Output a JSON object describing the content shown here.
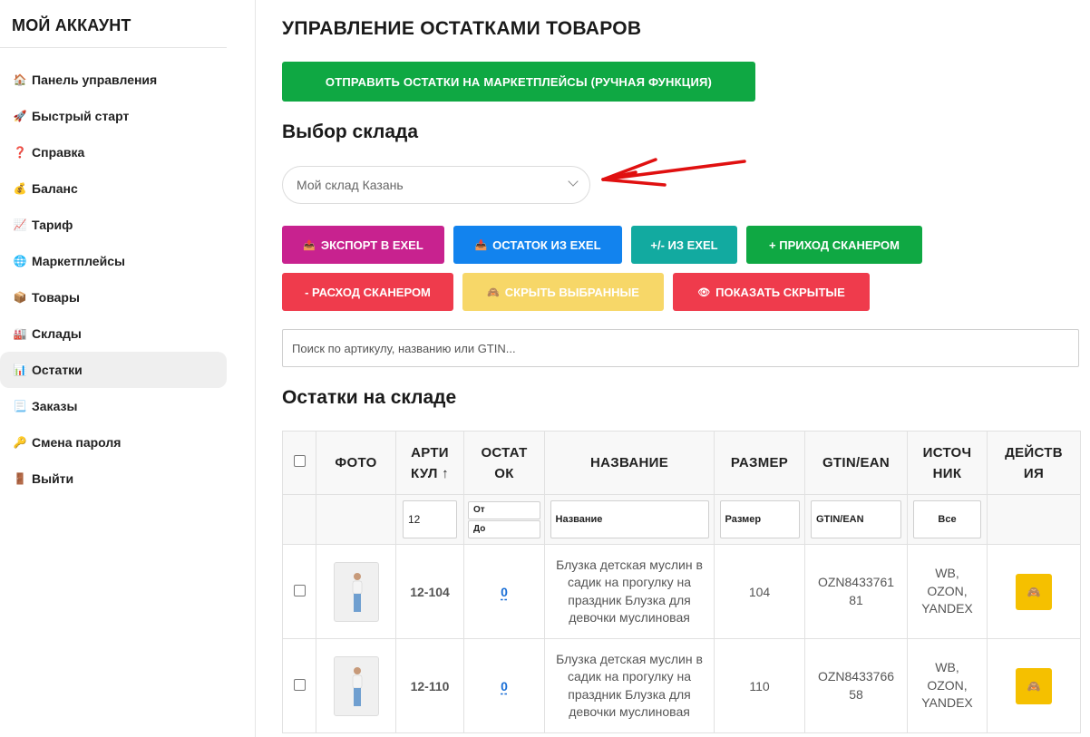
{
  "sidebar": {
    "title": "МОЙ АККАУНТ",
    "items": [
      {
        "icon": "🏠",
        "label": "Панель управления"
      },
      {
        "icon": "🚀",
        "label": "Быстрый старт"
      },
      {
        "icon": "❓",
        "label": "Справка"
      },
      {
        "icon": "💰",
        "label": "Баланс"
      },
      {
        "icon": "📈",
        "label": "Тариф"
      },
      {
        "icon": "🌐",
        "label": "Маркетплейсы"
      },
      {
        "icon": "📦",
        "label": "Товары"
      },
      {
        "icon": "🏭",
        "label": "Склады"
      },
      {
        "icon": "📊",
        "label": "Остатки"
      },
      {
        "icon": "📃",
        "label": "Заказы"
      },
      {
        "icon": "🔑",
        "label": "Смена пароля"
      },
      {
        "icon": "🚪",
        "label": "Выйти"
      }
    ]
  },
  "main": {
    "title": "УПРАВЛЕНИЕ ОСТАТКАМИ ТОВАРОВ",
    "send_button": "ОТПРАВИТЬ ОСТАТКИ НА МАРКЕТПЛЕЙСЫ (РУЧНАЯ ФУНКЦИЯ)",
    "warehouse_heading": "Выбор склада",
    "warehouse_selected": "Мой склад Казань",
    "buttons": {
      "export_icon": "📤",
      "export": "ЭКСПОРТ В EXEL",
      "import_icon": "📥",
      "import": "ОСТАТОК ИЗ EXEL",
      "plusminus": "+/- ИЗ EXEL",
      "income": "+ ПРИХОД СКАНЕРОМ",
      "outcome": "- РАСХОД СКАНЕРОМ",
      "hide_icon": "🙈",
      "hide": "СКРЫТЬ ВЫБРАННЫЕ",
      "show_icon": "👁",
      "show": "ПОКАЗАТЬ СКРЫТЫЕ"
    },
    "search_placeholder": "Поиск по артикулу, названию или GTIN...",
    "stock_heading": "Остатки на складе"
  },
  "table": {
    "headers": {
      "photo": "ФОТО",
      "article_1": "АРТИ",
      "article_2": "КУЛ ↑",
      "stock_1": "ОСТАТ",
      "stock_2": "ОК",
      "name": "НАЗВАНИЕ",
      "size": "РАЗМЕР",
      "gtin": "GTIN/EAN",
      "source_1": "ИСТОЧ",
      "source_2": "НИК",
      "actions_1": "ДЕЙСТВ",
      "actions_2": "ИЯ"
    },
    "filters": {
      "article_value": "12",
      "stock_from": "От",
      "stock_to": "До",
      "name": "Название",
      "size": "Размер",
      "gtin": "GTIN/EAN",
      "source": "Все"
    },
    "rows": [
      {
        "article": "12-104",
        "stock": "0",
        "name": "Блузка детская муслин в садик на прогулку на праздник Блузка для девочки муслиновая",
        "size": "104",
        "gtin_1": "OZN8433761",
        "gtin_2": "81",
        "source_1": "WB,",
        "source_2": "OZON,",
        "source_3": "YANDEX",
        "action_icon": "🙈"
      },
      {
        "article": "12-110",
        "stock": "0",
        "name": "Блузка детская муслин в садик на прогулку на праздник Блузка для девочки муслиновая",
        "size": "110",
        "gtin_1": "OZN8433766",
        "gtin_2": "58",
        "source_1": "WB,",
        "source_2": "OZON,",
        "source_3": "YANDEX",
        "action_icon": "🙈"
      }
    ]
  },
  "colors": {
    "green": "#0fa843",
    "magenta": "#c8228f",
    "blue": "#1283ee",
    "teal": "#12aaa0",
    "red": "#ef3b4c",
    "yellow": "#f7d768",
    "action_yellow": "#f5c000",
    "link_blue": "#1a6fd6",
    "annotation_red": "#e01010"
  }
}
